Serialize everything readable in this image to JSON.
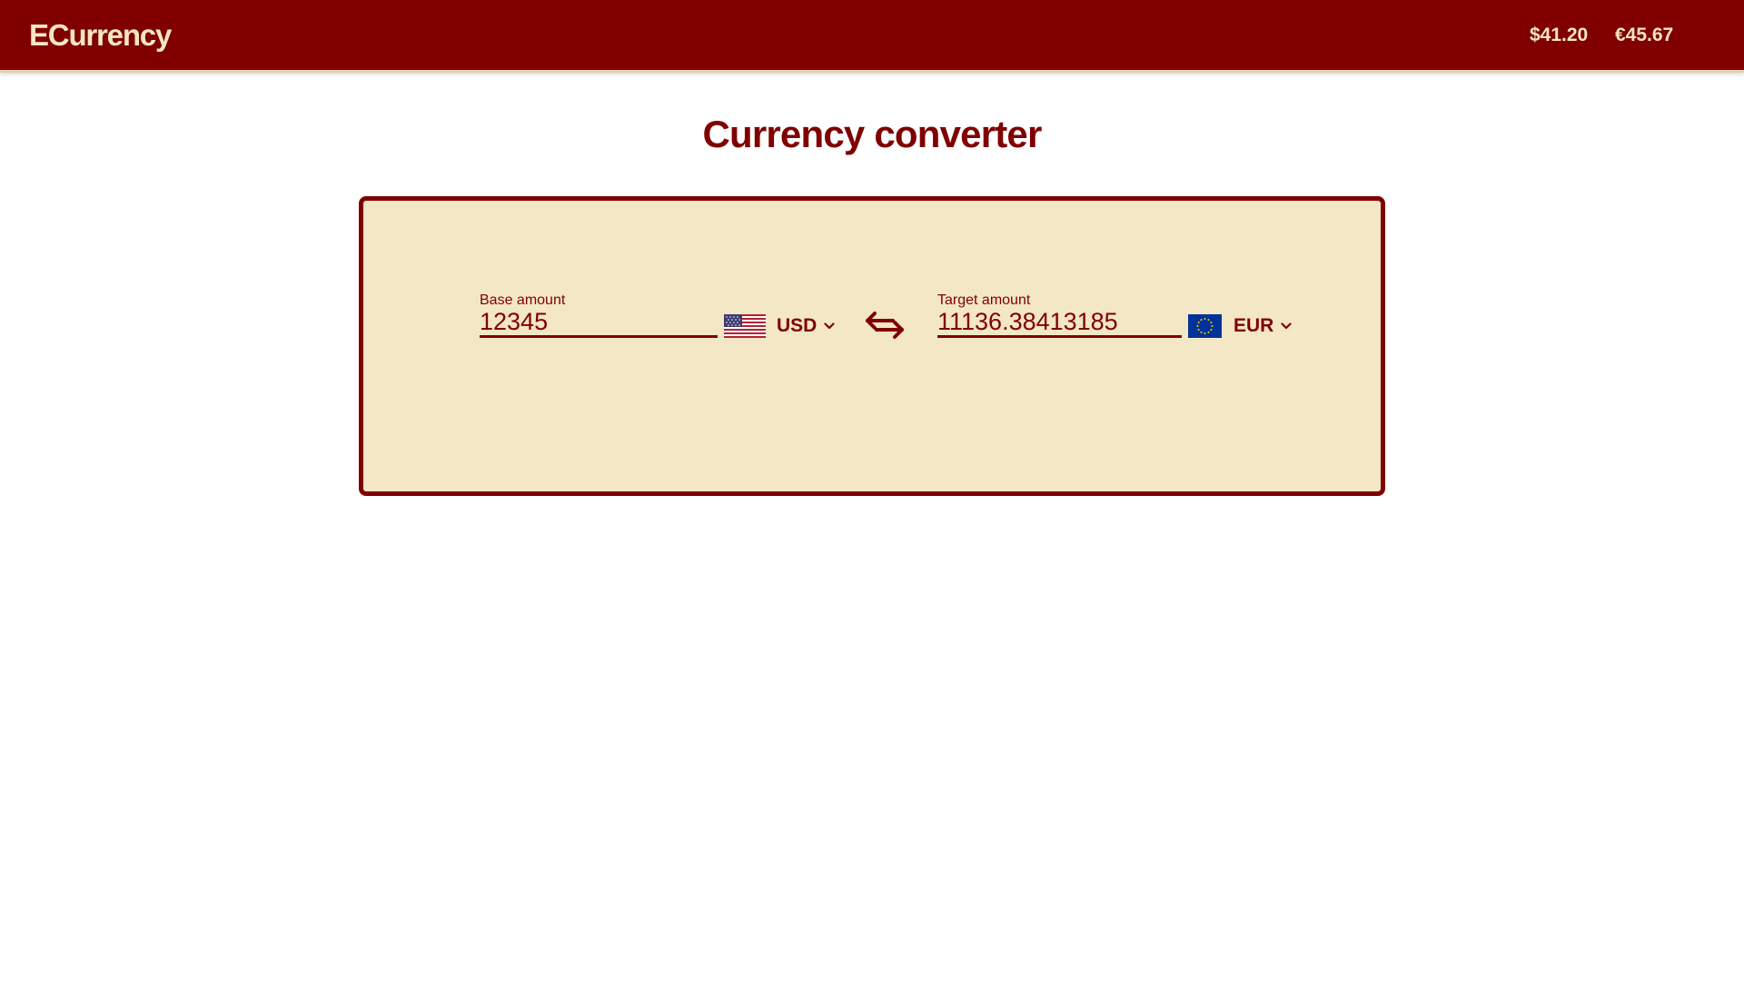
{
  "header": {
    "brand": "ECurrency",
    "rates": [
      {
        "label": "$41.20"
      },
      {
        "label": "€45.67"
      }
    ]
  },
  "page": {
    "title": "Currency converter"
  },
  "converter": {
    "base": {
      "label": "Base amount",
      "value": "12345",
      "currency": "USD",
      "flag_icon": "us-flag-icon"
    },
    "target": {
      "label": "Target amount",
      "value": "11136.38413185",
      "currency": "EUR",
      "flag_icon": "eu-flag-icon"
    },
    "swap_icon": "swap-arrows-icon"
  },
  "colors": {
    "primary": "#800000",
    "header_text": "#f5e6c4",
    "card_background": "#f3e7c6"
  }
}
